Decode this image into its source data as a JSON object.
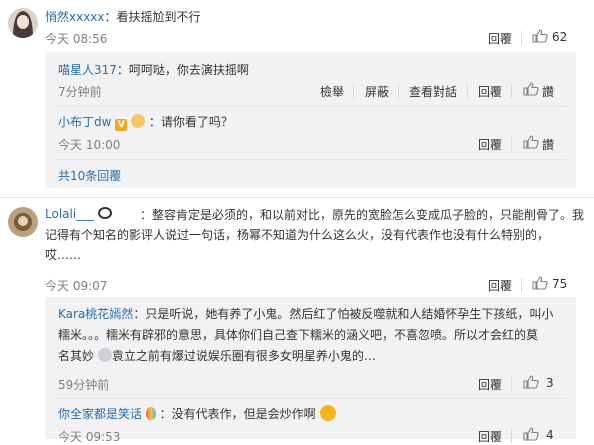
{
  "comments": [
    {
      "user": "悄然xxxxx",
      "text": "：看扶摇尬到不行",
      "time": "今天 08:56",
      "reply_label": "回覆",
      "likes": "62"
    },
    {
      "user": "Lolali___",
      "text_lines": [
        "：整容肯定是必须的，和以前对比，原先的宽脸怎么变成瓜子脸的，只能削骨了。我",
        "记得有个知名的影评人说过一句话，杨幂不知道为什么这么火，没有代表作也没有什么特别的，",
        "哎……"
      ],
      "time": "今天 09:07",
      "reply_label": "回覆",
      "likes": "75"
    }
  ],
  "replies_1": [
    {
      "user": "喵星人317",
      "text": "：呵呵哒，你去演扶摇啊",
      "time": "7分钟前",
      "actions": [
        "檢舉",
        "屏蔽",
        "查看對話",
        "回覆"
      ],
      "likes_label": "讚"
    },
    {
      "user": "小布丁dw",
      "text": "：请你看了吗？",
      "time": "今天 10:00",
      "actions": [
        "回覆"
      ],
      "likes_label": "讚"
    }
  ],
  "more_replies": "共10条回覆",
  "replies_2": [
    {
      "user": "Kara桃花嫣然",
      "text_lines": [
        "：只是听说，她有养了小鬼。然后红了怕被反噬就和人结婚怀孕生下孩纸，叫小",
        "糯米。。。糯米有辟邪的意思，具体你们自己查下糯米的涵义吧，不喜忽喷。所以才会红的莫",
        "名其妙",
        "袁立之前有爆过说娱乐圈有很多女明星养小鬼的…"
      ],
      "time": "59分钟前",
      "actions": [
        "回覆"
      ],
      "likes": "3"
    },
    {
      "user": "你全家都是笑话",
      "text": "：没有代表作，但是会炒作啊",
      "time": "今天 09:53",
      "actions": [
        "回覆"
      ],
      "likes": "4"
    }
  ]
}
